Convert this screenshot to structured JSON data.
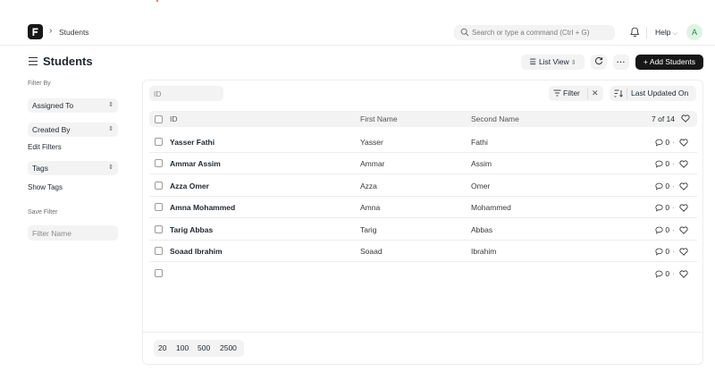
{
  "navbar": {
    "breadcrumb": "Students",
    "search_placeholder": "Search or type a command (Ctrl + G)",
    "help_label": "Help",
    "avatar_initial": "A"
  },
  "page": {
    "title": "Students",
    "list_view_label": "List View",
    "more_label": "···",
    "add_label": "+ Add Students"
  },
  "sidebar": {
    "filter_by": "Filter By",
    "assigned_to": "Assigned To",
    "created_by": "Created By",
    "edit_filters": "Edit Filters",
    "tags": "Tags",
    "show_tags": "Show Tags",
    "save_filter": "Save Filter",
    "filter_name_placeholder": "Filter Name"
  },
  "toolbar": {
    "id_placeholder": "ID",
    "filter_label": "Filter",
    "sort_label": "Last Updated On"
  },
  "table": {
    "headers": {
      "id": "ID",
      "first_name": "First Name",
      "second_name": "Second Name",
      "count": "7 of 14"
    },
    "rows": [
      {
        "id": "Yasser Fathi",
        "first_name": "Yasser",
        "second_name": "Fathi",
        "comments": "0"
      },
      {
        "id": "Ammar Assim",
        "first_name": "Ammar",
        "second_name": "Assim",
        "comments": "0"
      },
      {
        "id": "Azza Omer",
        "first_name": "Azza",
        "second_name": "Omer",
        "comments": "0"
      },
      {
        "id": "Amna Mohammed",
        "first_name": "Amna",
        "second_name": "Mohammed",
        "comments": "0"
      },
      {
        "id": "Tarig Abbas",
        "first_name": "Tarig",
        "second_name": "Abbas",
        "comments": "0"
      },
      {
        "id": "Soaad Ibrahim",
        "first_name": "Soaad",
        "second_name": "Ibrahim",
        "comments": "0"
      },
      {
        "id": "",
        "first_name": "",
        "second_name": "",
        "comments": "0"
      }
    ]
  },
  "pagination": {
    "sizes": [
      "20",
      "100",
      "500",
      "2500"
    ]
  },
  "colors": {
    "accent": "#171717",
    "avatar_bg": "#dcf5e3",
    "avatar_fg": "#2f7d48",
    "control_bg": "#f3f3f3"
  }
}
